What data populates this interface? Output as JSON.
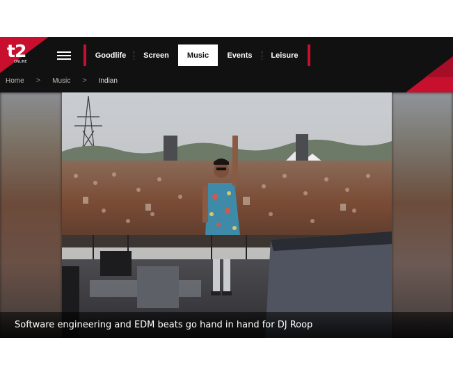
{
  "brand": {
    "logo_text": "t2",
    "logo_sub": "ONLINE"
  },
  "nav": {
    "items": [
      {
        "label": "Goodlife",
        "active": false
      },
      {
        "label": "Screen",
        "active": false
      },
      {
        "label": "Music",
        "active": true
      },
      {
        "label": "Events",
        "active": false
      },
      {
        "label": "Leisure",
        "active": false
      }
    ]
  },
  "breadcrumb": {
    "home": "Home",
    "section": "Music",
    "current": "Indian",
    "separator": ">"
  },
  "hero": {
    "caption": "Software engineering and EDM beats go hand in hand for DJ Roop"
  },
  "colors": {
    "header_bg": "#111111",
    "accent_red": "#c8102e",
    "active_tab_bg": "#ffffff"
  },
  "icons": {
    "menu": "hamburger-icon",
    "chevron": "chevron-right-icon"
  }
}
